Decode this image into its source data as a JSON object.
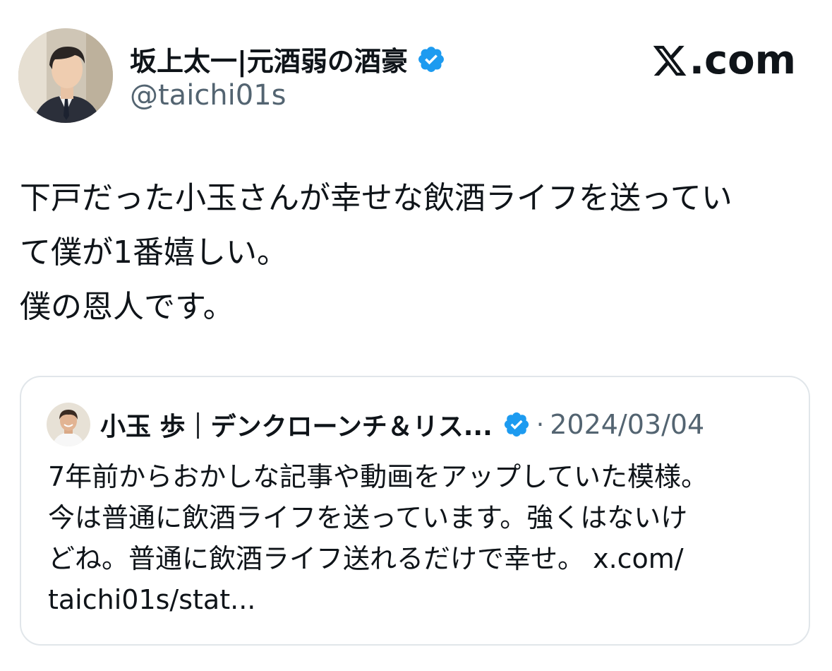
{
  "author": {
    "display_name": "坂上太一|元酒弱の酒豪",
    "handle": "@taichi01s",
    "verified": true,
    "avatar": "illustrated-man-in-suit-avatar"
  },
  "brand": {
    "logo_icon": "x-logo-icon",
    "text": ".com"
  },
  "post": {
    "lines": [
      "下戸だった小玉さんが幸せな飲酒ライフを送ってい",
      "て僕が1番嬉しい。",
      "僕の恩人です。"
    ]
  },
  "quoted_post": {
    "display_name": "小玉 歩｜デンクローンチ＆リス...",
    "verified": true,
    "separator": "·",
    "date": "2024/03/04",
    "avatar": "smiling-man-photo-avatar",
    "lines": [
      "7年前からおかしな記事や動画をアップしていた模様。",
      "今は普通に飲酒ライフを送っています。強くはないけ",
      "どね。普通に飲酒ライフ送れるだけで幸せ。 x.com/",
      "taichi01s/stat..."
    ]
  },
  "colors": {
    "verified_blue": "#1d9bf0",
    "secondary_text": "#536471",
    "primary_text": "#0f1419",
    "border": "#e1e6ea"
  }
}
